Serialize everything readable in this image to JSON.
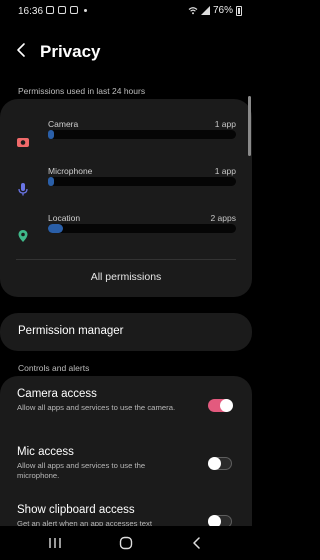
{
  "status_bar": {
    "time": "16:36",
    "battery": "76%"
  },
  "header": {
    "title": "Privacy"
  },
  "permissions_section": {
    "label": "Permissions used in last 24 hours",
    "items": [
      {
        "name": "Camera",
        "count": "1 app",
        "icon": "camera-icon",
        "icon_color": "#f06a6a",
        "usage_fraction": 0.03
      },
      {
        "name": "Microphone",
        "count": "1 app",
        "icon": "microphone-icon",
        "icon_color": "#6a75e6",
        "usage_fraction": 0.03
      },
      {
        "name": "Location",
        "count": "2 apps",
        "icon": "location-icon",
        "icon_color": "#3fb98a",
        "usage_fraction": 0.08
      }
    ],
    "all_permissions": "All permissions"
  },
  "permission_manager": {
    "label": "Permission manager"
  },
  "controls_section": {
    "label": "Controls and alerts",
    "items": [
      {
        "title": "Camera access",
        "desc": "Allow all apps and services to use the camera.",
        "on": true
      },
      {
        "title": "Mic access",
        "desc": "Allow all apps and services to use the microphone.",
        "on": false
      },
      {
        "title": "Show clipboard access",
        "desc": "Get an alert when an app accesses text",
        "on": false
      }
    ]
  },
  "colors": {
    "accent_toggle": "#e35a7e",
    "bar_fill": "#2a5fa8"
  },
  "nav": {
    "buttons": [
      "recents-icon",
      "home-icon",
      "back-icon"
    ]
  }
}
